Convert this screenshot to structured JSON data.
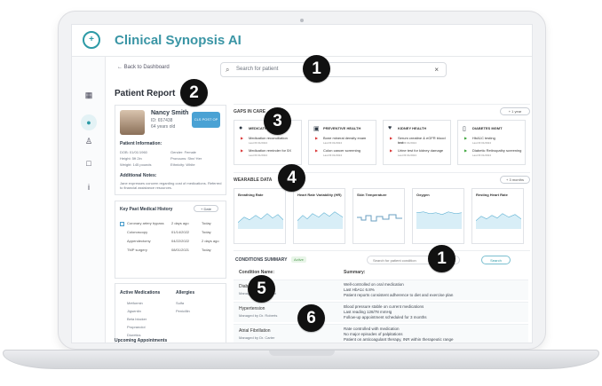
{
  "app": {
    "title": "Clinical Synopsis AI",
    "logo_icon": "heart-plus-icon"
  },
  "top_bar": {
    "back_label": "← Back to Dashboard",
    "search_placeholder": "Search for patient",
    "clear_icon": "close-icon"
  },
  "page": {
    "title": "Patient Report"
  },
  "patient": {
    "name": "Nancy Smith",
    "id": "ID: 657438",
    "age": "64 years old",
    "post_button": "CLS POST OP",
    "information_label": "Patient Information:",
    "dob": "DOB: 01/01/1960",
    "gender": "Gender: Female",
    "height": "Height: 5ft 2in",
    "pronouns": "Pronouns: She/ Her",
    "weight": "Weight: 145 pounds",
    "ethnicity": "Ethnicity: White",
    "notes_label": "Additional Notes:",
    "notes": "Jane expresses concern regarding cost of medications. Referred to financial assistance resources."
  },
  "history": {
    "title": "Key Past Medical History",
    "button": "+ Date",
    "rows": [
      {
        "name": "Coronary artery bypass",
        "when": "2 days ago",
        "date": "Today"
      },
      {
        "name": "Colonoscopy",
        "when": "01/14/2022",
        "date": "Today"
      },
      {
        "name": "Appendectomy",
        "when": "04/22/2022",
        "date": "2 days ago"
      },
      {
        "name": "TMP surgery",
        "when": "08/01/2021",
        "date": "Today"
      }
    ]
  },
  "medications": {
    "title": "Active Medications",
    "allergies_title": "Allergies",
    "items": [
      "Metformin",
      "Jigsentin",
      "Beta blocker",
      "Propranolol",
      "Diuretics"
    ],
    "allergies": [
      "Sulfa",
      "Penicillin"
    ]
  },
  "appointments": {
    "title": "Upcoming Appointments"
  },
  "gaps": {
    "title": "GAPS IN CARE",
    "range": "+ 1 year",
    "cards": [
      {
        "title": "MEDICATION",
        "icon": "pill-icon",
        "items": [
          "Medication reconciliation",
          "Medication reminder for 5X"
        ],
        "sub": [
          "Last fill 01/2024",
          "Last fill 01/2024"
        ]
      },
      {
        "title": "PREVENTIVE HEALTH",
        "icon": "shield-icon",
        "items": [
          "Bone mineral density exam",
          "Colon cancer screening"
        ],
        "sub": [
          "Last fill 01/2024",
          "Last fill 01/2024"
        ]
      },
      {
        "title": "KIDNEY HEALTH",
        "icon": "heart-icon",
        "items": [
          "Serum creatine & eGFR blood test",
          "Urine test for kidney damage"
        ],
        "sub": [
          "Last fill 01/2024",
          "Last fill 01/2024"
        ]
      },
      {
        "title": "DIABETES MGMT",
        "icon": "phone-icon",
        "items": [
          "HbA1C testing",
          "Diabetic Retinopathy screening"
        ],
        "sub": [
          "Last fill 01/2024",
          "Last fill 01/2024"
        ]
      }
    ]
  },
  "wearables": {
    "title": "WEARABLE DATA",
    "range": "+ 3 months",
    "cards": [
      {
        "title": "Breathing Rate"
      },
      {
        "title": "Heart Rate Variability (HR)"
      },
      {
        "title": "Skin Temperature"
      },
      {
        "title": "Oxygen"
      },
      {
        "title": "Resting Heart Rate"
      }
    ]
  },
  "conditions": {
    "title": "CONDITIONS SUMMARY",
    "status": "Active",
    "search_placeholder": "Search for patient condition",
    "search_button": "Search",
    "name_header": "Condition Name:",
    "summary_header": "Summary:",
    "rows": [
      {
        "name": "Diabetes Type 2",
        "date": "03/03/2024",
        "sub": "Managed by Dr. Sheron",
        "summary": [
          "Well-controlled on oral medication",
          "Last HbA1c 6.8%",
          "Patient reports consistent adherence to diet and exercise plan"
        ]
      },
      {
        "name": "Hypertension",
        "date": "",
        "sub": "Managed by Dr. Roberts",
        "summary": [
          "Blood pressure stable on current medications",
          "Last reading 128/78 mmHg",
          "Follow-up appointment scheduled for 3 months"
        ]
      },
      {
        "name": "Atrial Fibrillation",
        "date": "03/03/2024",
        "sub": "Managed by Dr. Carter",
        "summary": [
          "Rate controlled with medication",
          "No major episodes of palpitations",
          "Patient on anticoagulant therapy, INR within therapeutic range"
        ]
      }
    ]
  },
  "markers": [
    "1",
    "2",
    "3",
    "4",
    "1",
    "5",
    "6"
  ]
}
